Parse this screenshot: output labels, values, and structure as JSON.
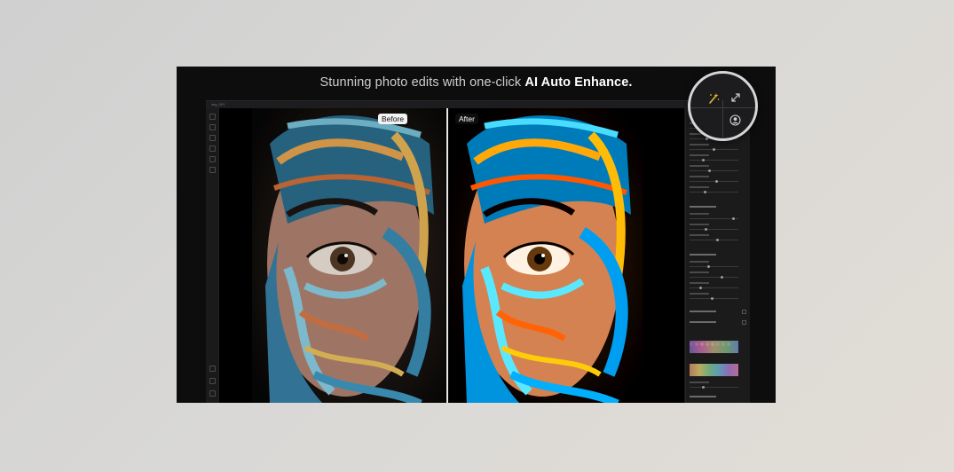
{
  "headline": {
    "prefix": "Stunning photo edits with one-click ",
    "emphasis": "AI Auto Enhance."
  },
  "editor": {
    "title": "img_001"
  },
  "comparison": {
    "before_label": "Before",
    "after_label": "After"
  },
  "magnifier": {
    "icons": [
      "magic-wand-icon",
      "expand-icon",
      "user-enhance-icon"
    ]
  },
  "colors": {
    "frame_bg": "#0d0d0e",
    "accent": "#e8b73a"
  }
}
